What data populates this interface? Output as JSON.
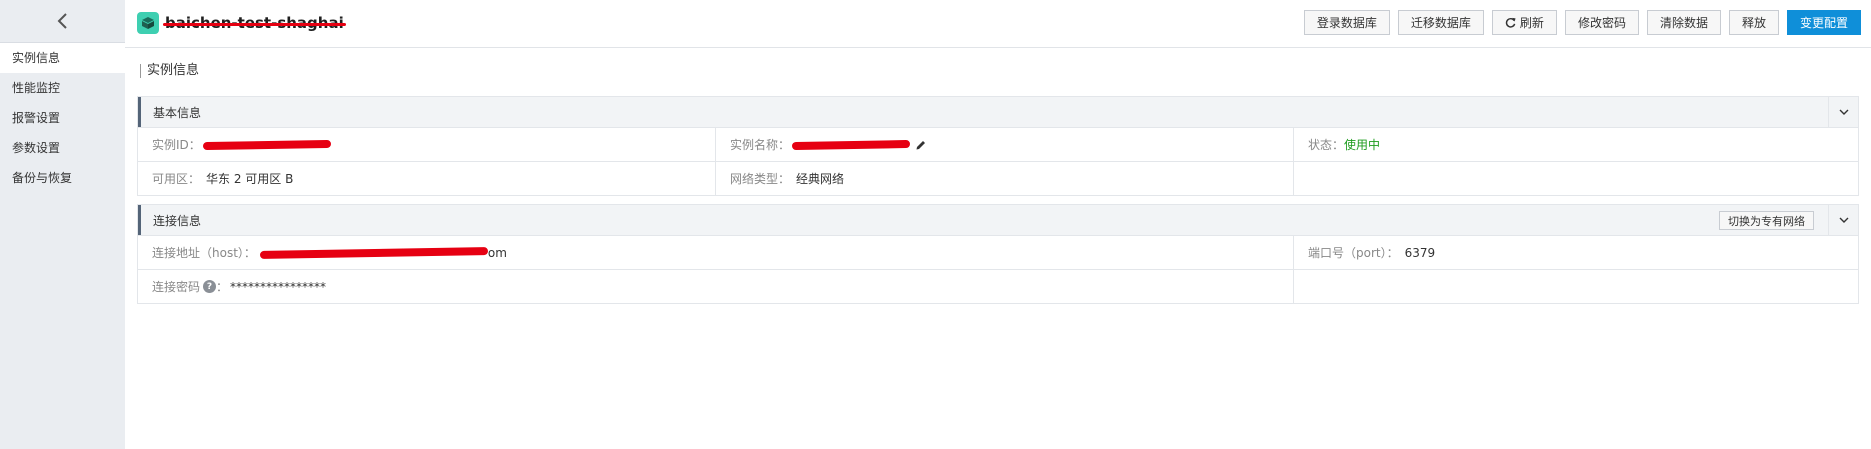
{
  "sidebar": {
    "items": [
      {
        "label": "实例信息",
        "active": true
      },
      {
        "label": "性能监控"
      },
      {
        "label": "报警设置"
      },
      {
        "label": "参数设置"
      },
      {
        "label": "备份与恢复"
      }
    ]
  },
  "header": {
    "title": "baichen-test-shaghai",
    "logo_icon": "database-cube-icon",
    "buttons": {
      "login_db": "登录数据库",
      "migrate_db": "迁移数据库",
      "refresh": "刷新",
      "change_password": "修改密码",
      "clear_data": "清除数据",
      "release": "释放",
      "change_config": "变更配置"
    },
    "accent_color": "#0f8fd9"
  },
  "main": {
    "section_title": "实例信息",
    "basic_panel": {
      "title": "基本信息",
      "instance_id_label": "实例ID：",
      "instance_name_label": "实例名称：",
      "status_label": "状态：",
      "status_value": "使用中",
      "zone_label": "可用区：",
      "zone_value": "华东 2 可用区 B",
      "network_label": "网络类型：",
      "network_value": "经典网络"
    },
    "connection_panel": {
      "title": "连接信息",
      "switch_button": "切换为专有网络",
      "host_label": "连接地址（host）：",
      "host_suffix": "om",
      "port_label": "端口号（port）：",
      "port_value": "6379",
      "password_label": "连接密码",
      "password_colon": "：",
      "password_value": "****************"
    }
  },
  "colors": {
    "status_green": "#1e9c1e",
    "redaction_red": "#e60012",
    "logo_teal": "#3ecfb1"
  }
}
